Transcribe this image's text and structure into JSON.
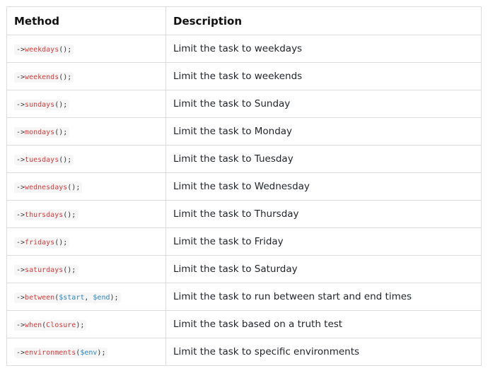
{
  "table": {
    "headers": [
      "Method",
      "Description"
    ],
    "rows": [
      {
        "arrow": "->",
        "fn": "weekdays",
        "open": "(",
        "arg1": "",
        "sep": "",
        "arg2": "",
        "close": ");",
        "desc": "Limit the task to weekdays"
      },
      {
        "arrow": "->",
        "fn": "weekends",
        "open": "(",
        "arg1": "",
        "sep": "",
        "arg2": "",
        "close": ");",
        "desc": "Limit the task to weekends"
      },
      {
        "arrow": "->",
        "fn": "sundays",
        "open": "(",
        "arg1": "",
        "sep": "",
        "arg2": "",
        "close": ");",
        "desc": "Limit the task to Sunday"
      },
      {
        "arrow": "->",
        "fn": "mondays",
        "open": "(",
        "arg1": "",
        "sep": "",
        "arg2": "",
        "close": ");",
        "desc": "Limit the task to Monday"
      },
      {
        "arrow": "->",
        "fn": "tuesdays",
        "open": "(",
        "arg1": "",
        "sep": "",
        "arg2": "",
        "close": ");",
        "desc": "Limit the task to Tuesday"
      },
      {
        "arrow": "->",
        "fn": "wednesdays",
        "open": "(",
        "arg1": "",
        "sep": "",
        "arg2": "",
        "close": ");",
        "desc": "Limit the task to Wednesday"
      },
      {
        "arrow": "->",
        "fn": "thursdays",
        "open": "(",
        "arg1": "",
        "sep": "",
        "arg2": "",
        "close": ");",
        "desc": "Limit the task to Thursday"
      },
      {
        "arrow": "->",
        "fn": "fridays",
        "open": "(",
        "arg1": "",
        "sep": "",
        "arg2": "",
        "close": ");",
        "desc": "Limit the task to Friday"
      },
      {
        "arrow": "->",
        "fn": "saturdays",
        "open": "(",
        "arg1": "",
        "sep": "",
        "arg2": "",
        "close": ");",
        "desc": "Limit the task to Saturday"
      },
      {
        "arrow": "->",
        "fn": "between",
        "open": "(",
        "arg1": "$start",
        "sep": ", ",
        "arg2": "$end",
        "close": ");",
        "desc": "Limit the task to run between start and end times"
      },
      {
        "arrow": "->",
        "fn": "when",
        "open": "(",
        "arg1": "Closure",
        "sep": "",
        "arg2": "",
        "close": ");",
        "desc": "Limit the task based on a truth test"
      },
      {
        "arrow": "->",
        "fn": "environments",
        "open": "(",
        "arg1": "$env",
        "sep": "",
        "arg2": "",
        "close": ");",
        "desc": "Limit the task to specific environments"
      }
    ],
    "arg_colors": {
      "between": [
        "var",
        "var"
      ],
      "when": [
        "fn"
      ],
      "environments": [
        "var"
      ]
    }
  }
}
